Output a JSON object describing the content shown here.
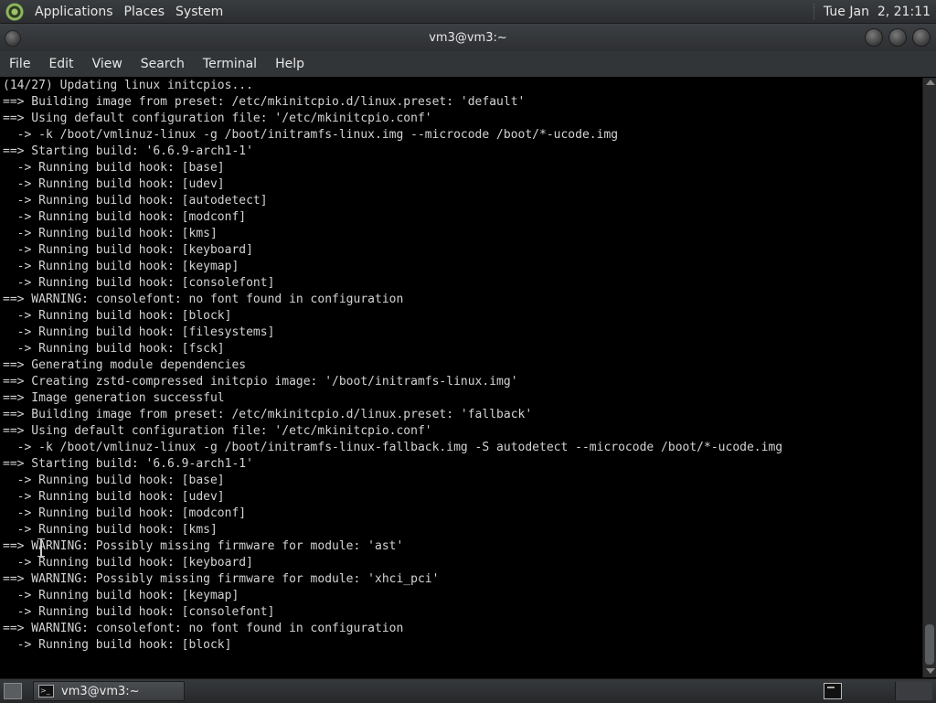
{
  "top_panel": {
    "menus": [
      "Applications",
      "Places",
      "System"
    ],
    "clock": "Tue Jan  2, 21:11"
  },
  "window": {
    "title": "vm3@vm3:~"
  },
  "menubar": [
    "File",
    "Edit",
    "View",
    "Search",
    "Terminal",
    "Help"
  ],
  "terminal": {
    "lines": [
      "(14/27) Updating linux initcpios...",
      "==> Building image from preset: /etc/mkinitcpio.d/linux.preset: 'default'",
      "==> Using default configuration file: '/etc/mkinitcpio.conf'",
      "  -> -k /boot/vmlinuz-linux -g /boot/initramfs-linux.img --microcode /boot/*-ucode.img",
      "==> Starting build: '6.6.9-arch1-1'",
      "  -> Running build hook: [base]",
      "  -> Running build hook: [udev]",
      "  -> Running build hook: [autodetect]",
      "  -> Running build hook: [modconf]",
      "  -> Running build hook: [kms]",
      "  -> Running build hook: [keyboard]",
      "  -> Running build hook: [keymap]",
      "  -> Running build hook: [consolefont]",
      "==> WARNING: consolefont: no font found in configuration",
      "  -> Running build hook: [block]",
      "  -> Running build hook: [filesystems]",
      "  -> Running build hook: [fsck]",
      "==> Generating module dependencies",
      "==> Creating zstd-compressed initcpio image: '/boot/initramfs-linux.img'",
      "==> Image generation successful",
      "==> Building image from preset: /etc/mkinitcpio.d/linux.preset: 'fallback'",
      "==> Using default configuration file: '/etc/mkinitcpio.conf'",
      "  -> -k /boot/vmlinuz-linux -g /boot/initramfs-linux-fallback.img -S autodetect --microcode /boot/*-ucode.img",
      "==> Starting build: '6.6.9-arch1-1'",
      "  -> Running build hook: [base]",
      "  -> Running build hook: [udev]",
      "  -> Running build hook: [modconf]",
      "  -> Running build hook: [kms]",
      "==> WARNING: Possibly missing firmware for module: 'ast'",
      "  -> Running build hook: [keyboard]",
      "==> WARNING: Possibly missing firmware for module: 'xhci_pci'",
      "  -> Running build hook: [keymap]",
      "  -> Running build hook: [consolefont]",
      "==> WARNING: consolefont: no font found in configuration",
      "  -> Running build hook: [block]"
    ]
  },
  "taskbar": {
    "task_label": "vm3@vm3:~"
  },
  "icons": {
    "app_menu": "distro-logo-icon",
    "task": "terminal-icon",
    "switcher": "workspace-switcher-icon"
  },
  "colors": {
    "terminal_bg": "#000000",
    "terminal_fg": "#d3d3d3",
    "panel_bg": "#2f3235"
  }
}
